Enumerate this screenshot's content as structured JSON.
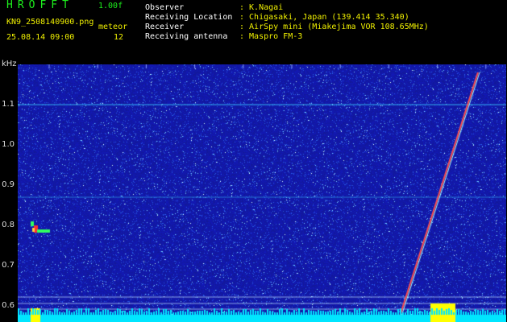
{
  "header": {
    "app_name": "HROFFT",
    "version": "1.00f",
    "filename": "KN9_2508140900.png",
    "mode": "meteor",
    "datetime": "25.08.14 09:00",
    "count": "12",
    "info": [
      {
        "label": "Observer",
        "value": ": K.Nagai"
      },
      {
        "label": "Receiving Location",
        "value": ": Chigasaki, Japan (139.414 35.340)"
      },
      {
        "label": "Receiver",
        "value": ": AirSpy mini (Miakejima VOR 108.65MHz)"
      },
      {
        "label": "Receiving antenna",
        "value": ": Maspro FM-3"
      }
    ]
  },
  "axis": {
    "y_unit": "kHz",
    "y_ticks": [
      "1.1",
      "1.0",
      "0.9",
      "0.8",
      "0.7",
      "0.6"
    ],
    "x_ticks": [
      "0901",
      "0902",
      "0903",
      "0904",
      "0905",
      "0906",
      "0907",
      "0908",
      "0909",
      "0910"
    ]
  },
  "colors": {
    "background": "#1a1f9e",
    "title": "#1df01d",
    "label": "#ffffff",
    "value": "#f0f000",
    "baseline": "#00e6ff",
    "burst": "#ffff00"
  }
}
